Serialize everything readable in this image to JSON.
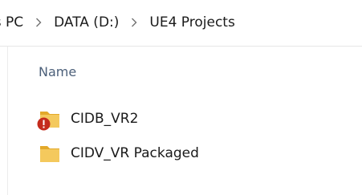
{
  "breadcrumb": {
    "items": [
      "is PC",
      "DATA (D:)",
      "UE4 Projects"
    ]
  },
  "list": {
    "column_header": "Name",
    "items": [
      {
        "name": "CIDB_VR2",
        "icon": "folder-icon",
        "status_icon": "error-icon"
      },
      {
        "name": "CIDV_VR Packaged",
        "icon": "folder-icon"
      }
    ]
  },
  "colors": {
    "folder": "#f4c95d",
    "folder_dark": "#e3a92b",
    "error": "#c42b1c",
    "header_text": "#4c607a"
  }
}
